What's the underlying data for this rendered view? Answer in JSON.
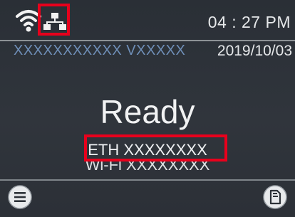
{
  "status": {
    "time": "04 : 27 PM",
    "icons": {
      "wifi": "wifi-icon",
      "network": "wired-network-icon"
    }
  },
  "info": {
    "model": "XXXXXXXXXXX  VXXXXX",
    "date": "2019/10/03"
  },
  "main": {
    "state": "Ready",
    "eth": "ETH XXXXXXXX",
    "wifi": "Wi-Fi XXXXXXXX"
  },
  "footer": {
    "menu_icon": "menu-icon",
    "function_icon": "document-icon"
  },
  "colors": {
    "highlight": "#e8001c",
    "background": "#2d3238",
    "text": "#e6e8ea"
  }
}
